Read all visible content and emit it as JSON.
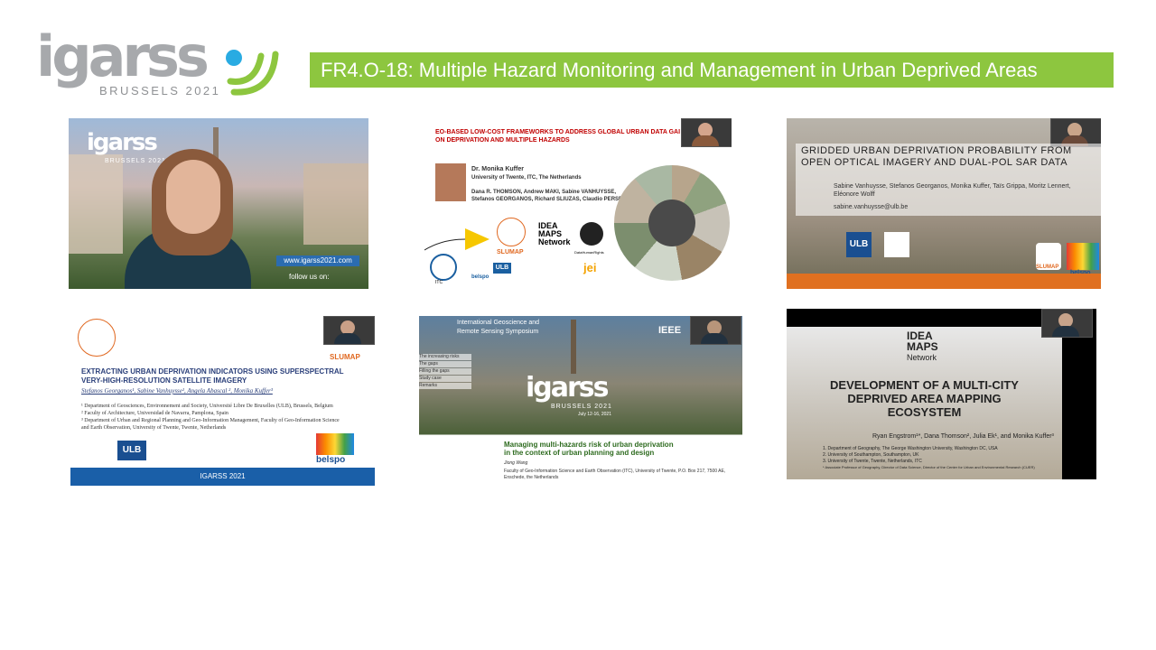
{
  "header": {
    "logo_word": "igarss",
    "logo_sub": "BRUSSELS 2021",
    "session_title": "FR4.O-18: Multiple Hazard Monitoring and Management in Urban Deprived Areas"
  },
  "tile1": {
    "logo": "igarss",
    "logo_sub": "BRUSSELS 2021",
    "url": "www.igarss2021.com",
    "follow": "follow us on:"
  },
  "tile2": {
    "title_line1": "EO-BASED LOW-COST FRAMEWORKS TO ADDRESS GLOBAL URBAN DATA GAI",
    "title_line2": "ON DEPRIVATION AND MULTIPLE HAZARDS",
    "presenter": "Dr. Monika Kuffer",
    "affiliation": "University of Twente, ITC, The Netherlands",
    "coauthors1": "Dana R. THOMSON, Andrew MAKI, Sabine VANHUYSSE,",
    "coauthors2": "Stefanos GEORGANOS, Richard SLIUZAS, Claudio PERSELLO",
    "slumap": "SLUMAP",
    "idea_maps": "IDEA MAPS Network",
    "jei": "jei",
    "datahumanrights": "DataHumanRights",
    "belspo": "belspo",
    "ulb": "ULB",
    "itc": "ITC"
  },
  "tile3": {
    "title_line1": "GRIDDED URBAN DEPRIVATION PROBABILITY FROM",
    "title_line2": "OPEN OPTICAL IMAGERY AND DUAL-POL SAR DATA",
    "authors": "Sabine Vanhuysse, Stefanos Georganos, Monika Kuffer, Taïs Grippa, Moritz Lennert, Eléonore Wolff",
    "email": "sabine.vanhuysse@ulb.be",
    "ulb": "ULB",
    "slumap": "SLUMAP",
    "belspo": "belspo"
  },
  "tile4": {
    "slumap": "SLUMAP",
    "title_line1": "EXTRACTING URBAN DEPRIVATION INDICATORS USING SUPERSPECTRAL",
    "title_line2": "VERY-HIGH-RESOLUTION SATELLITE IMAGERY",
    "authors": "Stefanos Georganos¹, Sabine Vanhuysse¹, Angela Abascal ², Monika Kuffer³",
    "aff1": "¹ Department of Geosciences, Environnement and Society, Université Libre De Bruxelles (ULB), Brussels, Belgium",
    "aff2": "² Faculty of Architecture, Universidad de Navarra, Pamplona, Spain",
    "aff3": "³ Department of Urban and Regional Planning and Geo-Information Management, Faculty of Geo-Information Science",
    "aff4": "and Earth Observation, University of Twente, Twente, Netherlands",
    "ulb": "ULB",
    "belspo": "belspo",
    "footer": "IGARSS 2021"
  },
  "tile5": {
    "symposium1": "International Geoscience and",
    "symposium2": "Remote Sensing Symposium",
    "menu": [
      "The increasing risks",
      "The gaps",
      "Filling the gaps",
      "Study case",
      "Remarks"
    ],
    "logo": "igarss",
    "logo_sub": "BRUSSELS 2021",
    "dates": "July 12-16, 2021",
    "ieee": "IEEE",
    "title1": "Managing multi-hazards risk of urban deprivation",
    "title2": "in the context of urban planning and design",
    "author": "Jiong Wang",
    "aff1": "Faculty of Geo-Information Science and Earth Observation (ITC), University of Twente, P.O. Box 217, 7500 AE,",
    "aff2": "Enschede, the Netherlands"
  },
  "tile6": {
    "logo1": "IDEA",
    "logo2": "MAPS",
    "logo3": "Network",
    "title1": "DEVELOPMENT OF A MULTI-CITY",
    "title2": "DEPRIVED AREA MAPPING",
    "title3": "ECOSYSTEM",
    "authors": "Ryan Engstrom¹*, Dana Thomson², Julia Ek¹, and Monika Kuffer³",
    "aff1": "1.     Department of Geography, The George Washington University, Washington DC, USA",
    "aff2": "2.     University of Southampton, Southampton, UK",
    "aff3": "3.     University of Twente, Twente, Netherlands, ITC",
    "note": "* Associate Professor of Geography, Director of Data Science, Director of the Center for Urban and Environmental Research (CUER)"
  }
}
